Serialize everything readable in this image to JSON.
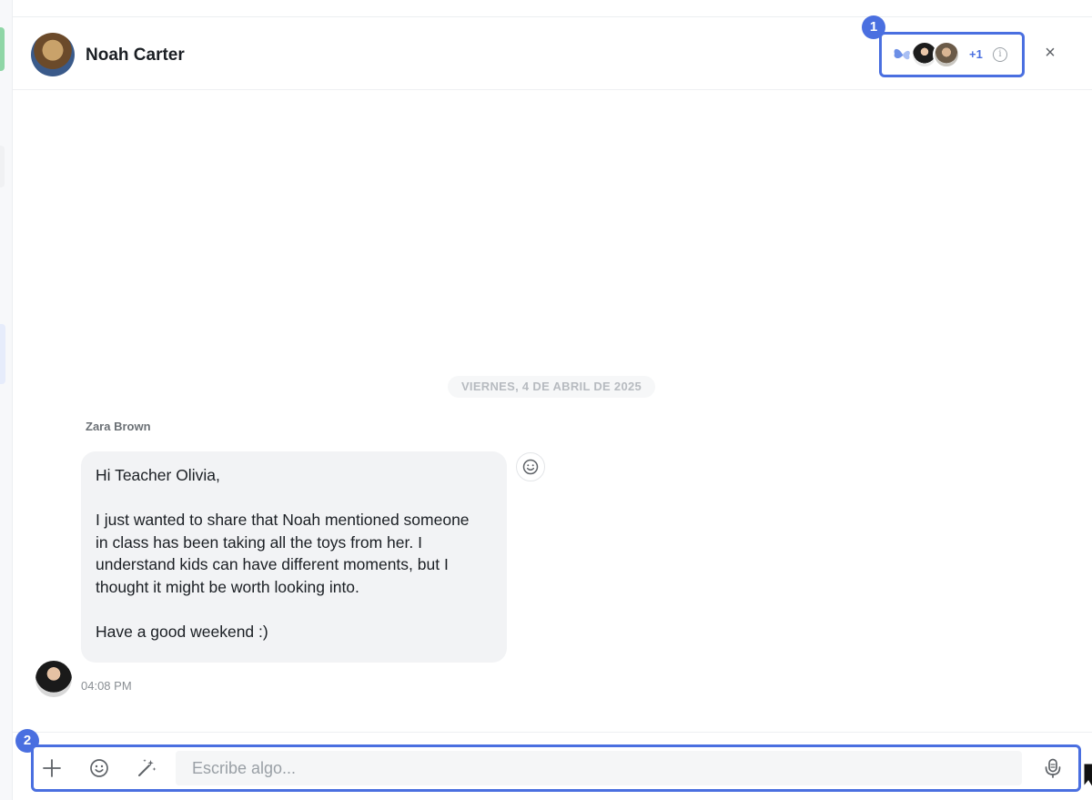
{
  "header": {
    "contact_name": "Noah Carter",
    "participants_more": "+1",
    "info_glyph": "i",
    "close_glyph": "×"
  },
  "annotations": {
    "badge_1": "1",
    "badge_2": "2",
    "highlight_color": "#4a6fe0"
  },
  "chat": {
    "date_separator": "VIERNES, 4 DE ABRIL DE 2025",
    "messages": [
      {
        "sender": "Zara Brown",
        "lines": [
          "Hi Teacher Olivia,",
          "",
          "I just wanted to share that Noah mentioned someone",
          "in class has been taking all the toys from her. I",
          "understand kids can have different moments, but I",
          "thought it might be worth looking into.",
          "",
          "Have a good weekend :)"
        ],
        "time": "04:08 PM"
      }
    ]
  },
  "composer": {
    "placeholder": "Escribe algo...",
    "value": "",
    "icons": [
      "plus-icon",
      "emoji-icon",
      "magic-wand-icon",
      "microphone-icon"
    ]
  }
}
